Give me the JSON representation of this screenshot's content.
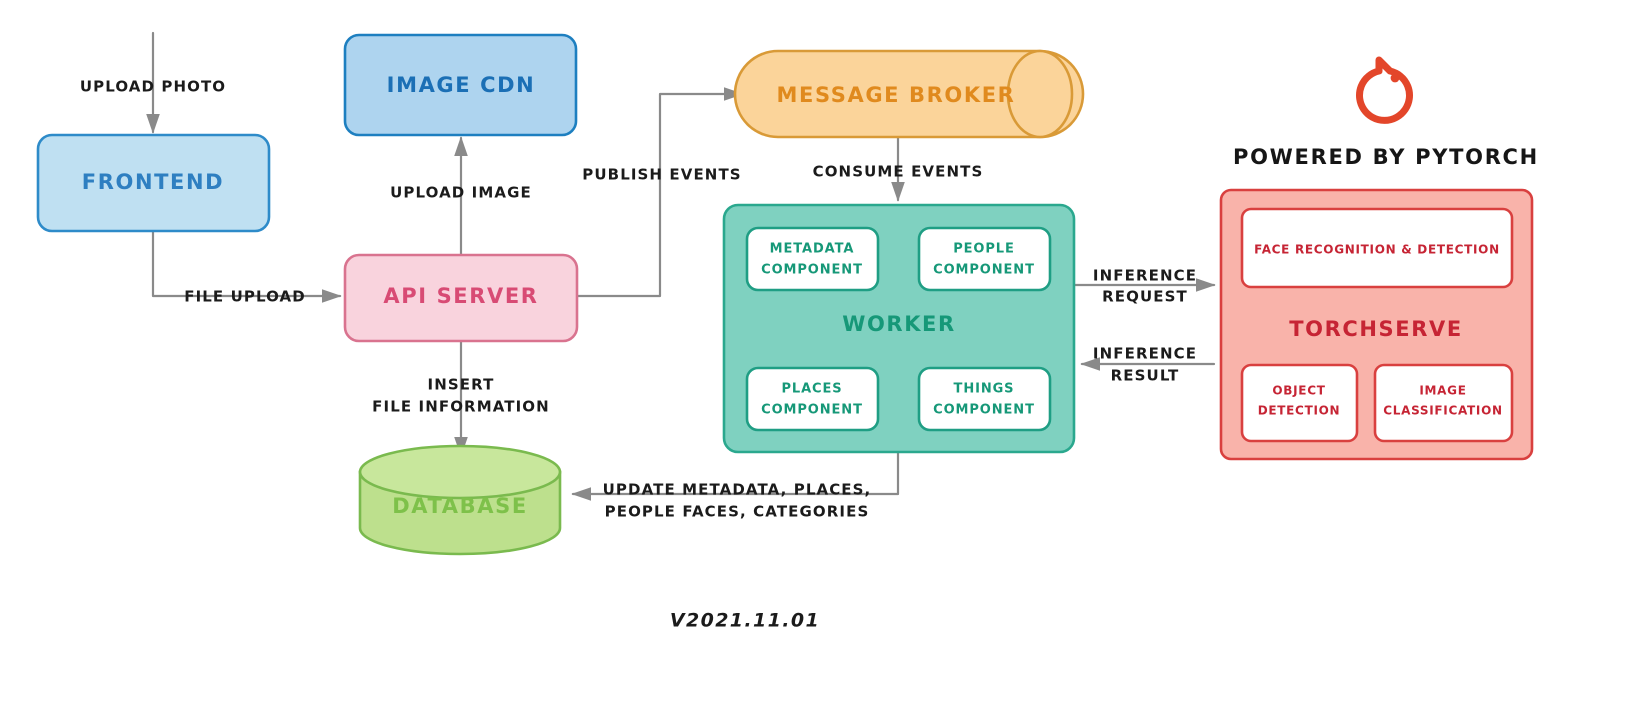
{
  "diagram": {
    "title": "Photo processing microservice architecture",
    "version_label": "V2021.11.01",
    "brand": {
      "logo_icon": "pytorch-flame-icon",
      "label": "POWERED BY PYTORCH",
      "color": "#e3462a"
    },
    "nodes": {
      "frontend": {
        "label": "FRONTEND",
        "shape": "rounded-rect",
        "fill": "#bfe0f2",
        "stroke": "#2e8bc9",
        "text": "#2e7fc1"
      },
      "image_cdn": {
        "label": "IMAGE CDN",
        "shape": "rounded-rect",
        "fill": "#aed4ef",
        "stroke": "#1d7fc0",
        "text": "#1b6fb5"
      },
      "api_server": {
        "label": "API SERVER",
        "shape": "rounded-rect",
        "fill": "#f9d3dd",
        "stroke": "#d9738f",
        "text": "#d84b74"
      },
      "message_broker": {
        "label": "MESSAGE BROKER",
        "shape": "cylinder-horizontal",
        "fill": "#fbd49a",
        "stroke": "#d99a37",
        "text": "#e08a1e"
      },
      "database": {
        "label": "DATABASE",
        "shape": "cylinder-vertical",
        "fill": "#bde08d",
        "stroke": "#7aba4e",
        "text": "#7ec14a"
      },
      "worker": {
        "label": "WORKER",
        "shape": "rounded-rect",
        "fill": "#7fd1c0",
        "stroke": "#2aa88e",
        "text": "#169878"
      },
      "torchserve": {
        "label": "TORCHSERVE",
        "shape": "rounded-rect",
        "fill": "#f9b3aa",
        "stroke": "#d9403f",
        "text": "#c62434"
      }
    },
    "worker_components": [
      {
        "line1": "METADATA",
        "line2": "COMPONENT"
      },
      {
        "line1": "PEOPLE",
        "line2": "COMPONENT"
      },
      {
        "line1": "PLACES",
        "line2": "COMPONENT"
      },
      {
        "line1": "THINGS",
        "line2": "COMPONENT"
      }
    ],
    "torchserve_components": {
      "top": {
        "line1": "FACE RECOGNITION & DETECTION",
        "line2": ""
      },
      "bottom": [
        {
          "line1": "OBJECT",
          "line2": "DETECTION"
        },
        {
          "line1": "IMAGE",
          "line2": "CLASSIFICATION"
        }
      ]
    },
    "edges": [
      {
        "id": "upload-photo",
        "line1": "UPLOAD PHOTO",
        "line2": ""
      },
      {
        "id": "file-upload",
        "line1": "FILE UPLOAD",
        "line2": ""
      },
      {
        "id": "upload-image",
        "line1": "UPLOAD IMAGE",
        "line2": ""
      },
      {
        "id": "publish-events",
        "line1": "PUBLISH EVENTS",
        "line2": ""
      },
      {
        "id": "consume-events",
        "line1": "CONSUME EVENTS",
        "line2": ""
      },
      {
        "id": "insert-file-info",
        "line1": "INSERT",
        "line2": "FILE INFORMATION"
      },
      {
        "id": "inference-request",
        "line1": "INFERENCE",
        "line2": "REQUEST"
      },
      {
        "id": "inference-result",
        "line1": "INFERENCE",
        "line2": "RESULT"
      },
      {
        "id": "update-database",
        "line1": "UPDATE  METADATA, PLACES,",
        "line2": "PEOPLE FACES, CATEGORIES"
      }
    ]
  }
}
